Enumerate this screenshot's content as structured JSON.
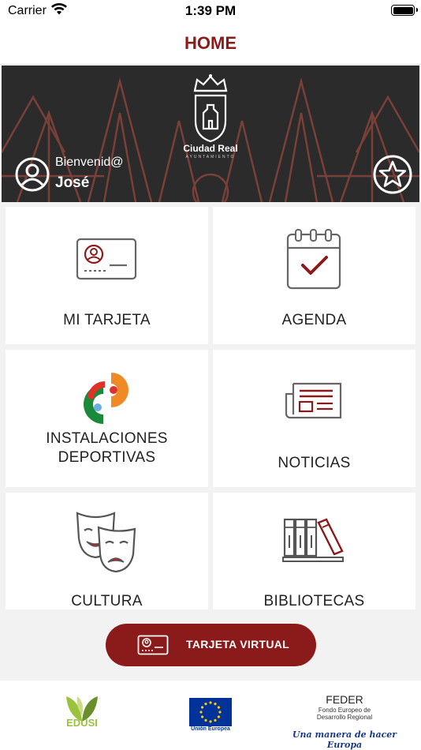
{
  "status_bar": {
    "carrier": "Carrier",
    "time": "1:39 PM"
  },
  "nav": {
    "title": "HOME"
  },
  "banner": {
    "city_name": "Ciudad Real",
    "city_sub": "AYUNTAMIENTO",
    "welcome": "Bienvenid@",
    "user_name": "José"
  },
  "tiles": [
    {
      "label": "MI TARJETA",
      "icon": "id-card-icon"
    },
    {
      "label": "AGENDA",
      "icon": "calendar-check-icon"
    },
    {
      "label_line1": "INSTALACIONES",
      "label_line2": "DEPORTIVAS",
      "icon": "sports-facilities-logo"
    },
    {
      "label": "NOTICIAS",
      "icon": "newspaper-icon"
    },
    {
      "label": "CULTURA",
      "icon": "theater-masks-icon"
    },
    {
      "label": "BIBLIOTECAS",
      "icon": "books-icon"
    }
  ],
  "virtual_card_button": {
    "label": "TARJETA VIRTUAL"
  },
  "footer": {
    "edusi": "EDUSI",
    "eu_label": "Unión Europea",
    "feder_title": "FEDER",
    "feder_line1": "Fondo Europeo de",
    "feder_line2": "Desarrollo Regional",
    "feder_motto": "Una manera de hacer Europa"
  },
  "colors": {
    "brand": "#8b1a1a",
    "banner_bg": "#2b2b2b",
    "icon_gray": "#666666"
  }
}
